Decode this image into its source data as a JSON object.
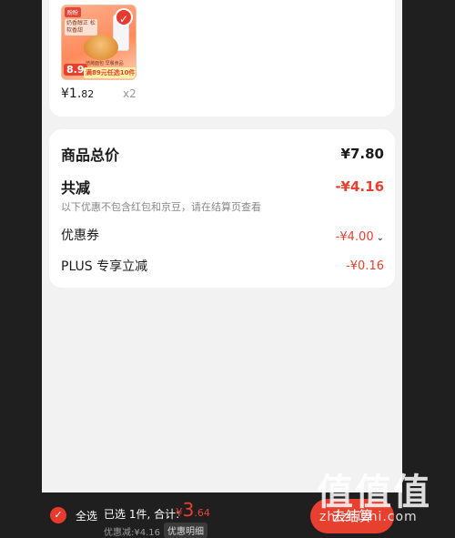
{
  "product": {
    "thumb": {
      "brand": "盼盼",
      "tagline": "奶香醇正 松软香甜",
      "price_big": "8.9",
      "promo_sub": "焙烤面包 早餐食品",
      "promo": "满89元任选10件"
    },
    "price_symbol": "¥",
    "price_int": "1.",
    "price_dec": "82",
    "quantity": "x2"
  },
  "summary": {
    "goods_total_label": "商品总价",
    "goods_total_value": "¥7.80",
    "total_discount_label": "共减",
    "total_discount_value": "-¥4.16",
    "note": "以下优惠不包含红包和京豆，请在结算页查看",
    "coupon_label": "优惠券",
    "coupon_value": "-¥4.00",
    "plus_label": "PLUS 专享立减",
    "plus_value": "-¥0.16"
  },
  "bottom": {
    "select_all": "全选",
    "selected_count": "已选 1件, 合计:",
    "total_symbol": "¥",
    "total_int": "3",
    "total_dec": ".64",
    "discount_text": "优惠减:¥4.16",
    "discount_detail": "优惠明细",
    "checkout": "去结算"
  },
  "watermark": {
    "big": "值值值",
    "small": "zhizhizhi.com"
  },
  "colors": {
    "accent": "#e8402f",
    "background": "#1f1f1f",
    "panel": "#f2f2f2"
  }
}
